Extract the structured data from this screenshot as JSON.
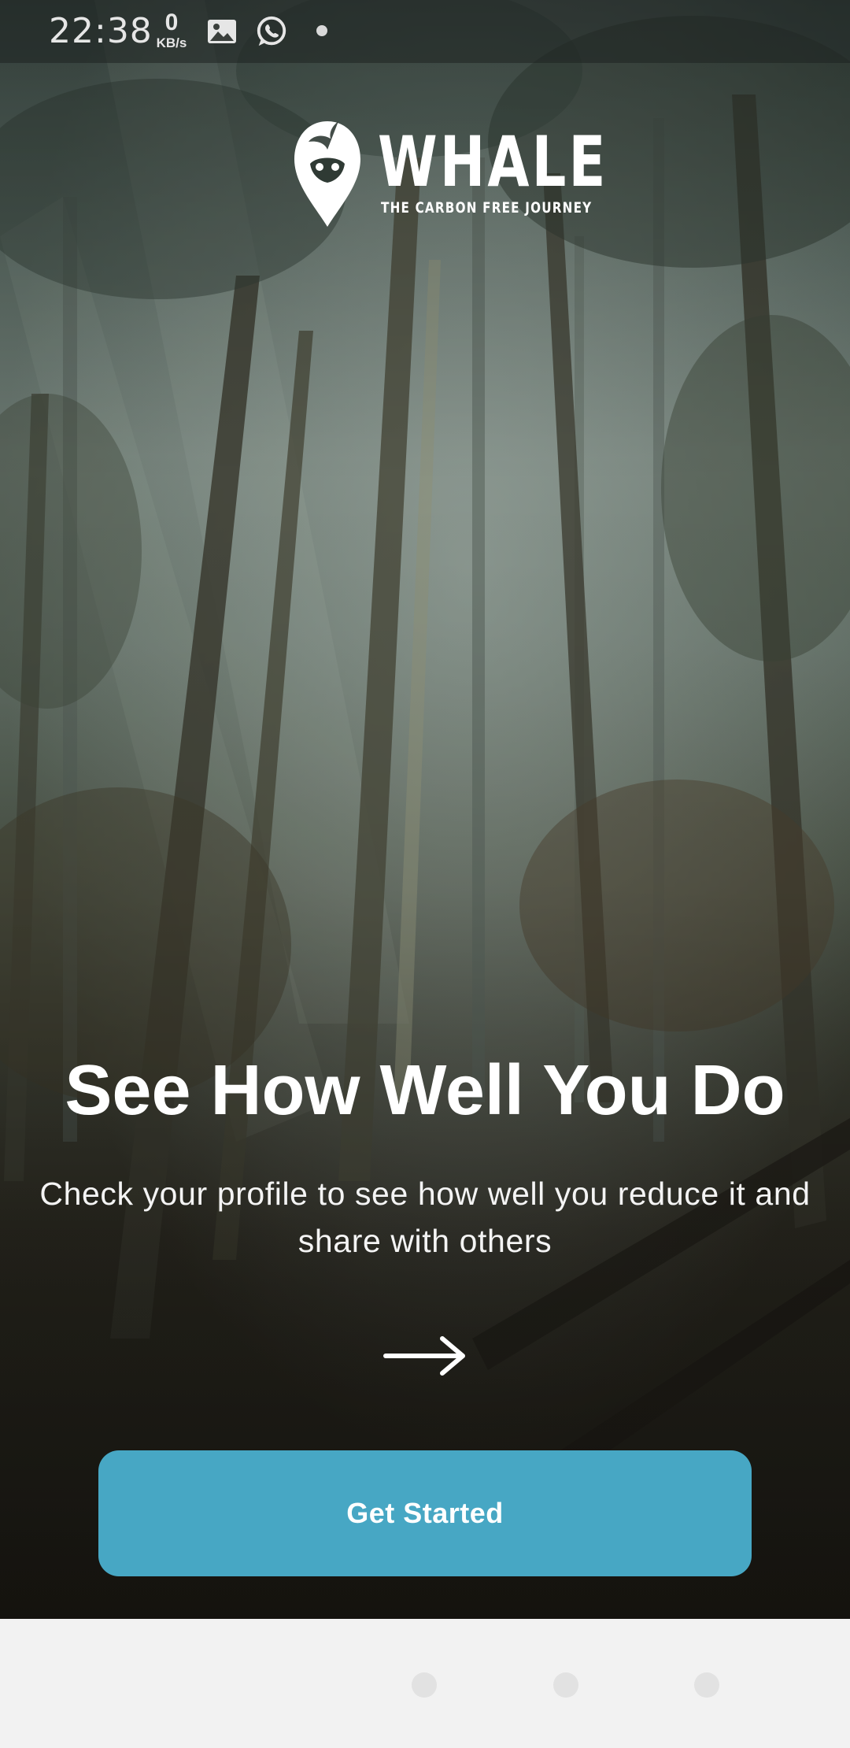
{
  "status_bar": {
    "time": "22:38",
    "net_speed_value": "0",
    "net_speed_unit": "KB/s",
    "icons": [
      "gallery-icon",
      "whatsapp-icon",
      "notification-dot-icon"
    ]
  },
  "logo": {
    "wordmark": "WHALE",
    "tagline": "THE CARBON FREE JOURNEY",
    "icon": "whale-logo-icon"
  },
  "onboarding": {
    "title": "See How Well You Do",
    "description": "Check your profile to see how well you reduce it and share with others",
    "next_icon": "arrow-right-icon",
    "button_label": "Get Started"
  },
  "bottom_nav": {
    "icons": [
      "nav-dot-icon",
      "nav-dot-icon",
      "nav-dot-icon"
    ]
  },
  "colors": {
    "accent": "#47a7c4",
    "text": "#ffffff",
    "bottom_background": "#f2f2f2"
  }
}
